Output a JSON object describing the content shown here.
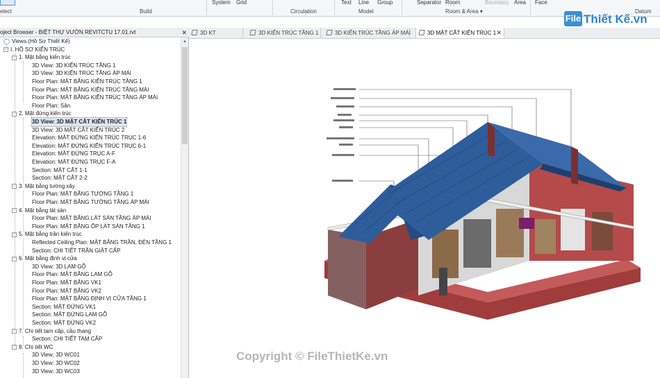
{
  "ribbon": {
    "select_label": "elect",
    "build_label": "Build",
    "system_label": "System",
    "grid_label": "Grid",
    "circulation_label": "Circulation",
    "text_label": "Text",
    "line_label": "Line",
    "group_label": "Group",
    "model_label": "Model",
    "separator_label": "Separator",
    "room_label": "Room",
    "boundary_label": "Boundary",
    "area_label": "Area",
    "room_area_label": "Room & Area",
    "face_label": "Face",
    "datum_label": "Datum"
  },
  "logo": {
    "mark": "File",
    "text": "Thiết Kế.vn"
  },
  "browser": {
    "title": "oject Browser - BIỆT THỰ VƯỜN REVITCTU 17.01.rvt",
    "close": "✕",
    "items": [
      {
        "label": "Views (Hồ Sơ Thiết Kế)"
      },
      {
        "label": "I. HỒ SƠ KIẾN TRÚC"
      },
      {
        "label": "1. Mặt bằng kiến trúc"
      },
      {
        "label": "3D View: 3D KIẾN TRÚC TẦNG 1"
      },
      {
        "label": "3D View: 3D KIẾN TRÚC TẦNG ÁP MÁI"
      },
      {
        "label": "Floor Plan: MẶT BẰNG KIẾN TRÚC TẦNG 1"
      },
      {
        "label": "Floor Plan: MẶT BẰNG KIẾN TRÚC TẦNG MÁI"
      },
      {
        "label": "Floor Plan: MẶT BẰNG KIẾN TRÚC TẦNG ÁP MÁI"
      },
      {
        "label": "Floor Plan: Sân"
      },
      {
        "label": "2. Mặt đứng kiến trúc"
      },
      {
        "label": "3D View: 3D MẶT CẮT KIẾN TRÚC 1"
      },
      {
        "label": "3D View: 3D MẶT CẮT KIẾN TRÚC 2"
      },
      {
        "label": "Elevation: MẶT ĐỨNG KIẾN TRÚC TRỤC 1-6"
      },
      {
        "label": "Elevation: MẶT ĐỨNG KIẾN TRÚC TRỤC 6-1"
      },
      {
        "label": "Elevation: MẶT ĐỨNG TRỤC A-F"
      },
      {
        "label": "Elevation: MẶT ĐỨNG TRỤC F-A"
      },
      {
        "label": "Section: MẶT CẮT 1-1"
      },
      {
        "label": "Section: MẶT CẮT 2-2"
      },
      {
        "label": "3. Mặt bằng tường xây"
      },
      {
        "label": "Floor Plan: MẶT BẰNG TƯỜNG TẦNG 1"
      },
      {
        "label": "Floor Plan: MẶT BẰNG TƯỜNG TẦNG ÁP MÁI"
      },
      {
        "label": "4. Mặt bằng lát sàn"
      },
      {
        "label": "Floor Plan: MẶT BẰNG LÁT SÀN TẦNG ÁP MÁI"
      },
      {
        "label": "Floor Plan: MẶT BẰNG ỐP LÁT SÀN TẦNG 1"
      },
      {
        "label": "5. Mặt bằng trần kiến trúc"
      },
      {
        "label": "Reflected Ceiling Plan: MẶT BẰNG TRẦN, ĐÈN TẦNG 1"
      },
      {
        "label": "Section: CHI TIẾT TRẦN GIẬT CẤP"
      },
      {
        "label": "6. Mặt bằng định vị cửa"
      },
      {
        "label": "3D View: 3D LAM GỖ"
      },
      {
        "label": "Floor Plan: MẶT BẰNG LAM GỖ"
      },
      {
        "label": "Floor Plan: MẶT BẰNG VK1"
      },
      {
        "label": "Floor Plan: MẶT BẰNG VK2"
      },
      {
        "label": "Floor Plan: MẶT BẰNG ĐỊNH VỊ CỬA TẦNG 1"
      },
      {
        "label": "Section: MẶT ĐỨNG VK1"
      },
      {
        "label": "Section: MẶT ĐỨNG LAM GỖ"
      },
      {
        "label": "Section: MẶT ĐỨNG VK2"
      },
      {
        "label": "7. Chi tiết tam cấp, cầu thang"
      },
      {
        "label": "Section: CHI TIẾT TAM CẤP"
      },
      {
        "label": "8. Chi tiết WC"
      },
      {
        "label": "3D View: 3D WC01"
      },
      {
        "label": "3D View: 3D WC02"
      },
      {
        "label": "3D View: 3D WC03"
      }
    ]
  },
  "tabs": [
    {
      "label": "3D KT"
    },
    {
      "label": "3D KIẾN TRÚC TẦNG 1"
    },
    {
      "label": "3D KIẾN TRÚC TẦNG ÁP MÁI"
    },
    {
      "label": "3D MẶT CẮT KIẾN TRÚC 1",
      "close": "✕"
    }
  ],
  "watermark": "Copyright © FileThietKe.vn",
  "colors": {
    "roof": "#2e5d9b",
    "wall": "#a84b4b",
    "floor": "#c45a5a",
    "accent": "#2a86d1"
  }
}
